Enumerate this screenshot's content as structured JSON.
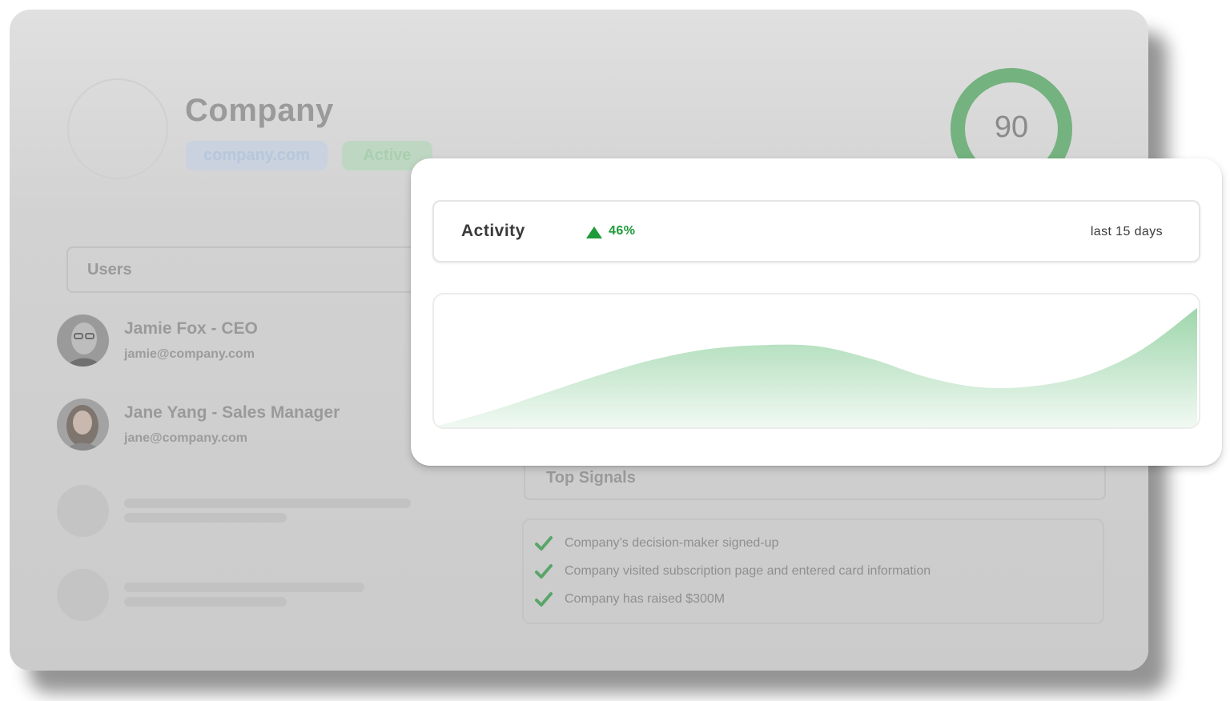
{
  "company": {
    "name": "Company",
    "domain": "company.com",
    "status": "Active",
    "score": "90",
    "score_fraction": 0.9
  },
  "users": {
    "title": "Users",
    "list": [
      {
        "name": "Jamie Fox - CEO",
        "email": "jamie@company.com"
      },
      {
        "name": "Jane Yang - Sales Manager",
        "email": "jane@company.com"
      }
    ]
  },
  "signals": {
    "title": "Top Signals",
    "items": [
      "Company’s decision-maker signed-up",
      "Company visited subscription page and entered card information",
      "Company has raised $300M"
    ]
  },
  "activity": {
    "title": "Activity",
    "trend": "46%",
    "range": "last 15 days"
  },
  "colors": {
    "accent_green": "#1f9a3a",
    "gauge_green": "#74b27f",
    "area_green": "#9ed6ab"
  },
  "chart_data": {
    "type": "area",
    "x": [
      1,
      2,
      3,
      4,
      5,
      6,
      7,
      8,
      9,
      10,
      11,
      12,
      13,
      14,
      15
    ],
    "series": [
      {
        "values": [
          0,
          12,
          26,
          40,
          52,
          60,
          63,
          62,
          52,
          38,
          30,
          31,
          40,
          60,
          92
        ]
      }
    ],
    "ylim": [
      0,
      100
    ]
  }
}
